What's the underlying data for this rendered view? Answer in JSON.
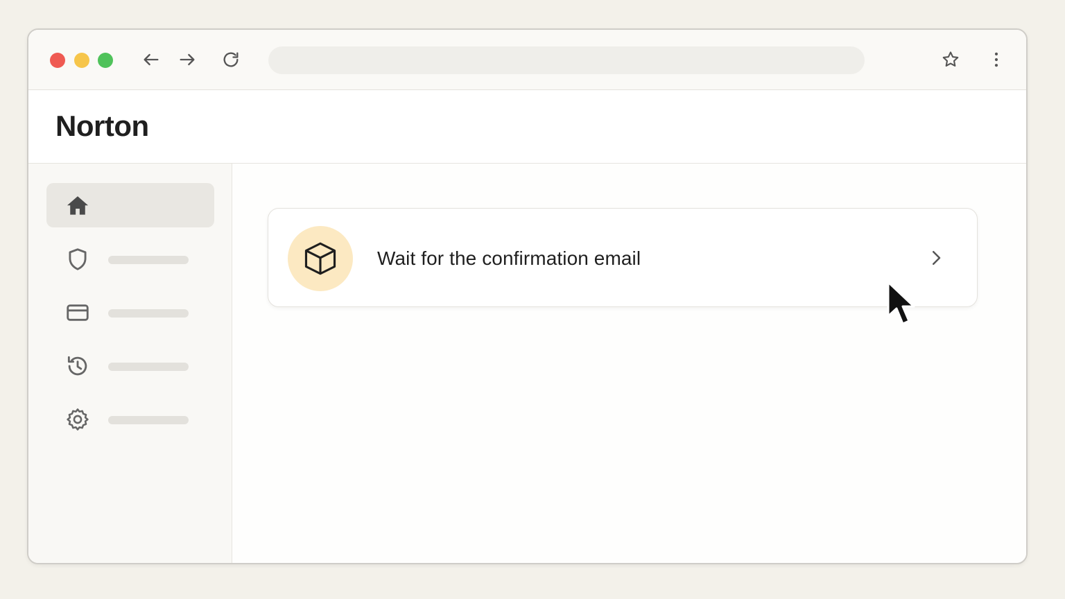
{
  "browser": {
    "toolbar_icons": [
      "back-arrow-icon",
      "forward-arrow-icon",
      "reload-icon",
      "star-icon",
      "kebab-menu-icon"
    ],
    "window_controls": [
      "close-dot",
      "minimize-dot",
      "maximize-dot"
    ]
  },
  "app": {
    "brand": "Norton"
  },
  "sidebar": {
    "items": [
      {
        "icon": "home-icon",
        "active": true
      },
      {
        "icon": "shield-icon",
        "active": false
      },
      {
        "icon": "credit-card-icon",
        "active": false
      },
      {
        "icon": "history-icon",
        "active": false
      },
      {
        "icon": "gear-icon",
        "active": false
      }
    ]
  },
  "main": {
    "task_card": {
      "title": "Wait for the confirmation email",
      "icon": "package-box-icon",
      "action_icon": "chevron-right-icon"
    }
  },
  "colors": {
    "accent_circle": "#fce9c2",
    "traffic_red": "#ef5a52",
    "traffic_yellow": "#f6c54a",
    "traffic_green": "#4fc25a"
  }
}
